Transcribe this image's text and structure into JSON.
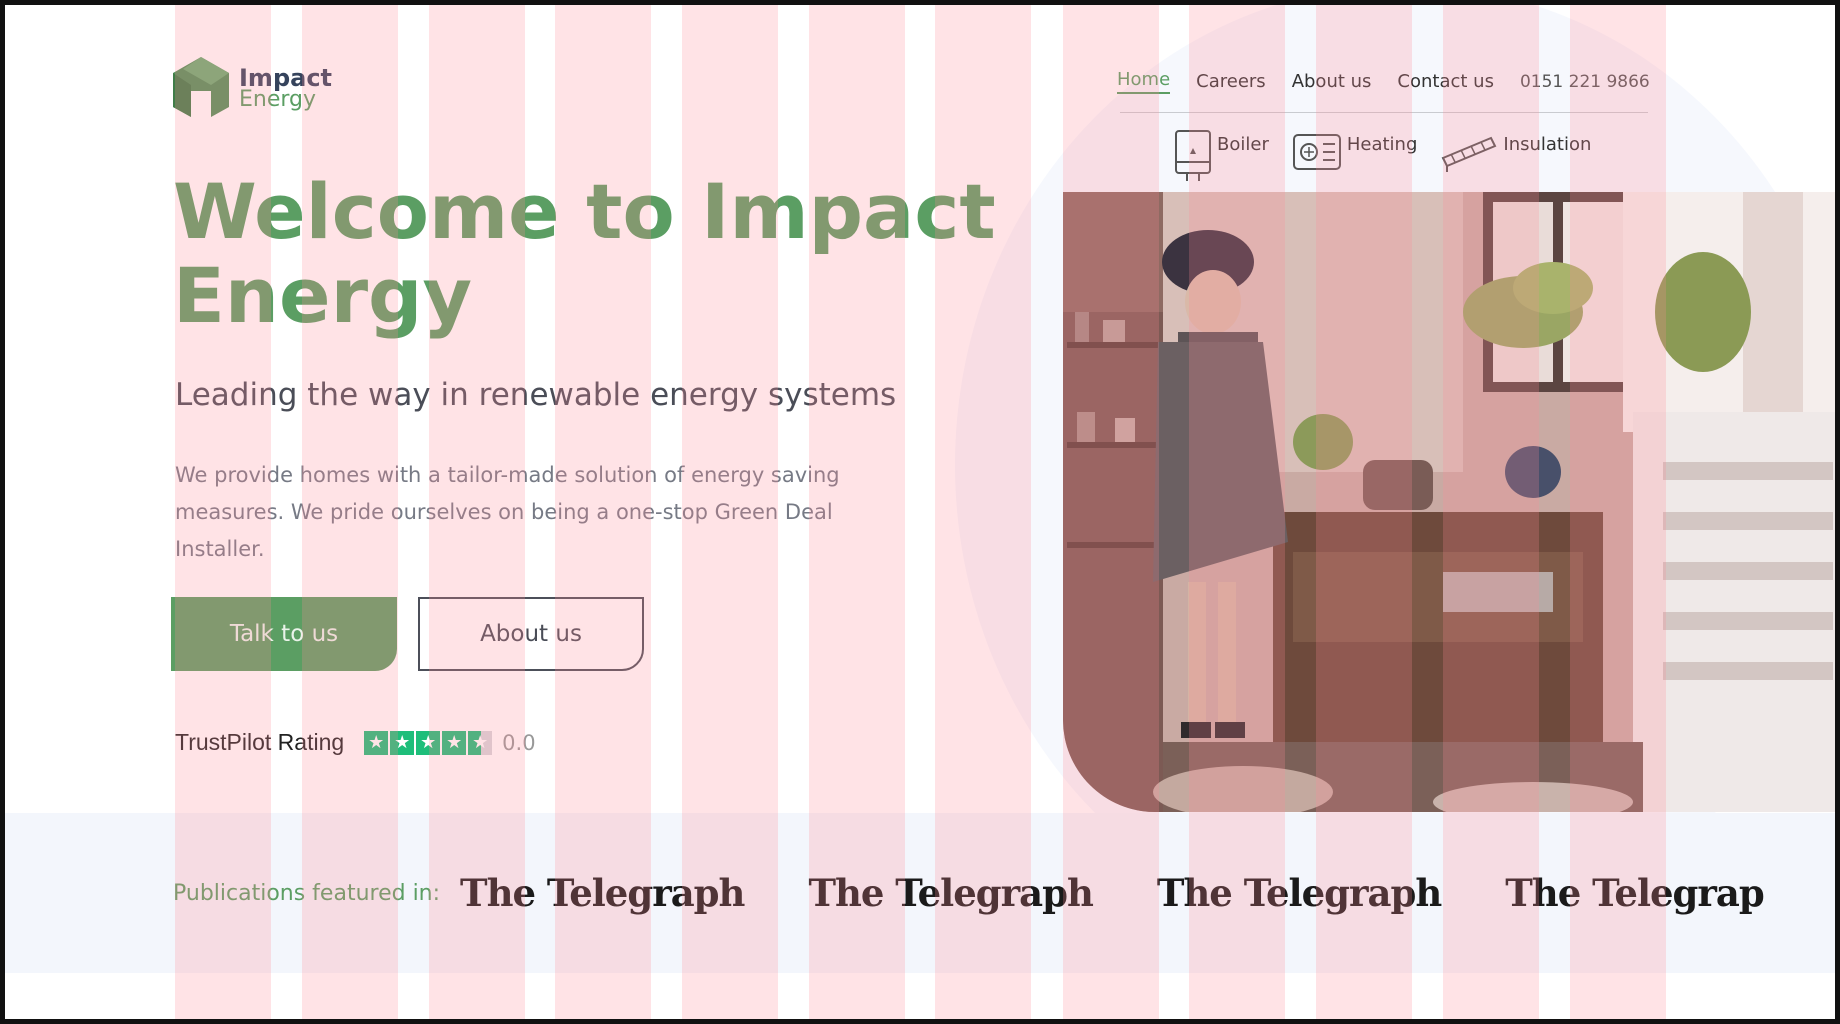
{
  "brand": {
    "line1": "Impact",
    "line2": "Energy",
    "accent": "#5b9e63"
  },
  "nav": {
    "items": [
      {
        "label": "Home",
        "active": true
      },
      {
        "label": "Careers",
        "active": false
      },
      {
        "label": "About us",
        "active": false
      },
      {
        "label": "Contact us",
        "active": false
      }
    ],
    "phone": "0151 221 9866"
  },
  "services": [
    {
      "label": "Boiler",
      "icon": "boiler-icon"
    },
    {
      "label": "Heating",
      "icon": "radiator-icon"
    },
    {
      "label": "Insulation",
      "icon": "insulation-icon"
    }
  ],
  "hero": {
    "title": "Welcome to Impact Energy",
    "subtitle": "Leading the way in renewable energy systems",
    "description": "We provide homes with a tailor-made solution of energy saving measures. We pride ourselves on being a one-stop Green Deal Installer.",
    "primary_button": "Talk to us",
    "secondary_button": "About us"
  },
  "rating": {
    "label": "TrustPilot Rating",
    "score": "0.0",
    "stars_filled": 4.5,
    "stars_total": 5
  },
  "publications": {
    "label": "Publications featured in:",
    "logos": [
      "The Telegraph",
      "The Telegraph",
      "The Telegraph",
      "The Telegrap"
    ]
  },
  "colors": {
    "primary": "#5b9e63",
    "text_dark": "#4a4d57",
    "grid_overlay": "#ffb6bf",
    "trustpilot": "#1ebe7a"
  }
}
